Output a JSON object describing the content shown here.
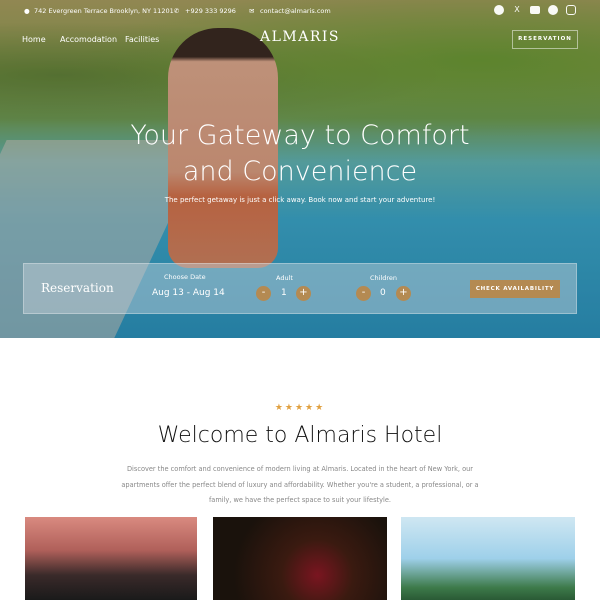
{
  "topbar": {
    "address": "742 Evergreen Terrace Brooklyn, NY 11201",
    "phone": "+929 333 9296",
    "email": "contact@almaris.com",
    "social": [
      "facebook-icon",
      "x-icon",
      "youtube-icon",
      "pinterest-icon",
      "instagram-icon"
    ]
  },
  "nav": {
    "items": [
      "Home",
      "Accomodation",
      "Facilities"
    ],
    "logo": "ALMARIS",
    "reservation": "RESERVATION"
  },
  "hero": {
    "title_line1": "Your Gateway to Comfort",
    "title_line2": "and Convenience",
    "subtitle": "The perfect getaway is just a click away. Book now and start your adventure!"
  },
  "booking": {
    "title": "Reservation",
    "date_label": "Choose Date",
    "date_value": "Aug 13 - Aug 14",
    "adult_label": "Adult",
    "adult_value": "1",
    "children_label": "Children",
    "children_value": "0",
    "minus": "-",
    "plus": "+",
    "check": "CHECK AVAILABILITY"
  },
  "welcome": {
    "stars": "★★★★★",
    "rating": 5,
    "title": "Welcome to Almaris Hotel",
    "description": "Discover the comfort and convenience of modern living at Almaris. Located in the heart of New York, our apartments offer the perfect blend of luxury and affordability. Whether you're a student, a professional, or a family, we have the perfect space to suit your lifestyle."
  },
  "colors": {
    "accent": "#b48a52",
    "stars": "#e0a040"
  }
}
